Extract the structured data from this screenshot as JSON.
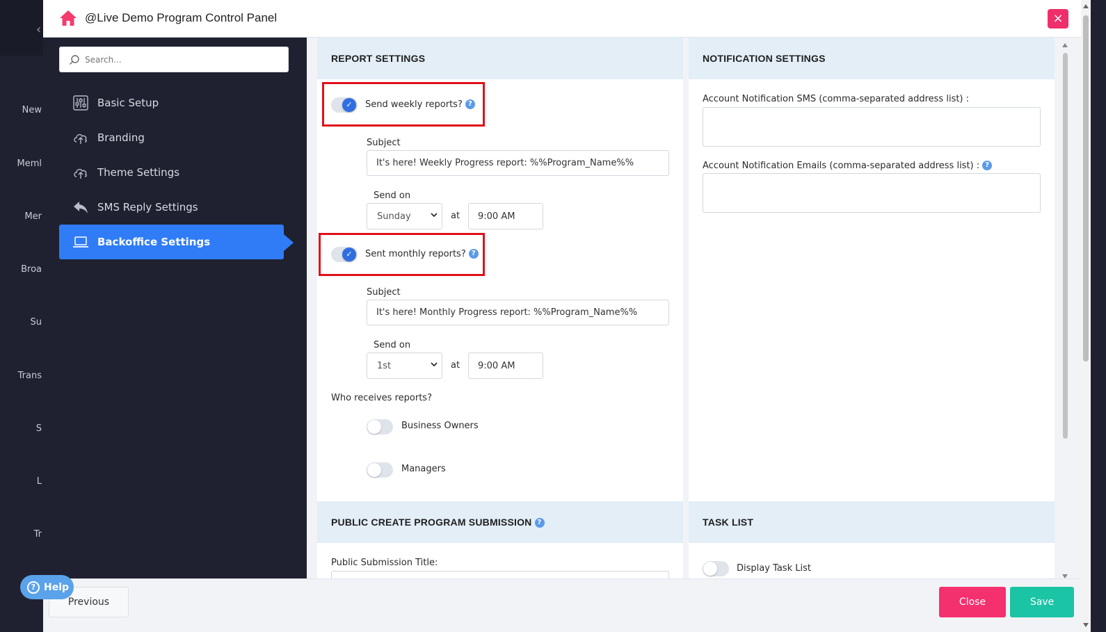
{
  "bg_sidebar": {
    "labels": [
      "New",
      "Meml",
      "Mer",
      "Broa",
      "Su",
      "Trans",
      "S",
      "L",
      "Tr"
    ]
  },
  "modal": {
    "title": "@Live Demo Program Control Panel",
    "close_label": "×"
  },
  "search": {
    "placeholder": "Search..."
  },
  "nav": {
    "items": [
      {
        "label": "Basic Setup",
        "icon": "sliders-icon"
      },
      {
        "label": "Branding",
        "icon": "cloud-upload-icon"
      },
      {
        "label": "Theme Settings",
        "icon": "cloud-upload-icon"
      },
      {
        "label": "SMS Reply Settings",
        "icon": "reply-icon"
      },
      {
        "label": "Backoffice Settings",
        "icon": "laptop-icon",
        "active": true
      }
    ]
  },
  "report_settings": {
    "heading": "REPORT SETTINGS",
    "weekly": {
      "toggle_label": "Send weekly reports?",
      "enabled": true,
      "subject_label": "Subject",
      "subject_value": "It's here! Weekly Progress report: %%Program_Name%%",
      "send_on_label": "Send on",
      "day": "Sunday",
      "at_label": "at",
      "time": "9:00 AM"
    },
    "monthly": {
      "toggle_label": "Sent monthly reports?",
      "enabled": true,
      "subject_label": "Subject",
      "subject_value": "It's here! Monthly Progress report: %%Program_Name%%",
      "send_on_label": "Send on",
      "day": "1st",
      "at_label": "at",
      "time": "9:00 AM"
    },
    "recipients_label": "Who receives reports?",
    "recipients": [
      {
        "label": "Business Owners",
        "enabled": false
      },
      {
        "label": "Managers",
        "enabled": false
      }
    ]
  },
  "notification_settings": {
    "heading": "NOTIFICATION SETTINGS",
    "sms_label": "Account Notification SMS (comma-separated address list) :",
    "sms_value": "",
    "email_label": "Account Notification Emails (comma-separated address list) :",
    "email_value": ""
  },
  "public_submission": {
    "heading": "PUBLIC CREATE PROGRAM SUBMISSION",
    "title_label": "Public Submission Title:"
  },
  "task_list": {
    "heading": "TASK LIST",
    "display_label": "Display Task List",
    "enabled": false
  },
  "footer": {
    "previous_label": "Previous",
    "close_label": "Close",
    "save_label": "Save"
  },
  "help": {
    "label": "Help"
  },
  "colors": {
    "accent": "#2f7cf6",
    "close": "#f4306f",
    "save": "#1bc4a5",
    "highlight": "#e0101a",
    "nav_bg": "#1f2130",
    "section_head": "#e3eef7"
  }
}
